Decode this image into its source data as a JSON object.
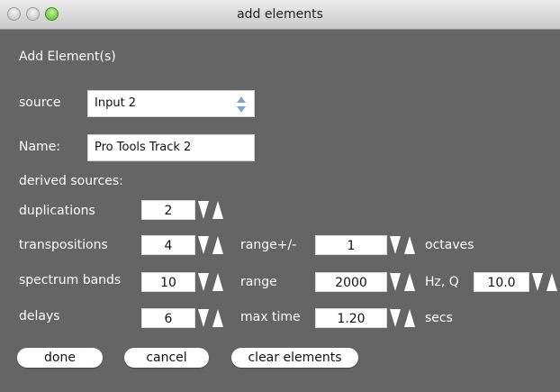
{
  "window": {
    "title": "add elements"
  },
  "dialog": {
    "heading": "Add Element(s)",
    "source": {
      "label": "source",
      "value": "Input 2"
    },
    "name": {
      "label": "Name:",
      "value": "Pro Tools Track 2"
    },
    "derived_sources_label": "derived sources:",
    "duplications": {
      "label": "duplications",
      "value": "2"
    },
    "transpositions": {
      "label": "transpositions",
      "value": "4",
      "range_label": "range+/-",
      "range_value": "1",
      "unit": "octaves"
    },
    "spectrum_bands": {
      "label": "spectrum bands",
      "value": "10",
      "range_label": "range",
      "range_value": "2000",
      "unit": "Hz, Q",
      "q_value": "10.0"
    },
    "delays": {
      "label": "delays",
      "value": "6",
      "max_time_label": "max time",
      "max_time_value": "1.20",
      "unit": "secs"
    },
    "buttons": {
      "done": "done",
      "cancel": "cancel",
      "clear_elements": "clear elements"
    }
  },
  "colors": {
    "background": "#656565",
    "text": "#ffffff",
    "accent": "#6e9bd6"
  },
  "icons": [
    "window-close-icon",
    "window-minimize-icon",
    "window-zoom-icon",
    "popup-arrows-icon",
    "stepper-icon"
  ]
}
